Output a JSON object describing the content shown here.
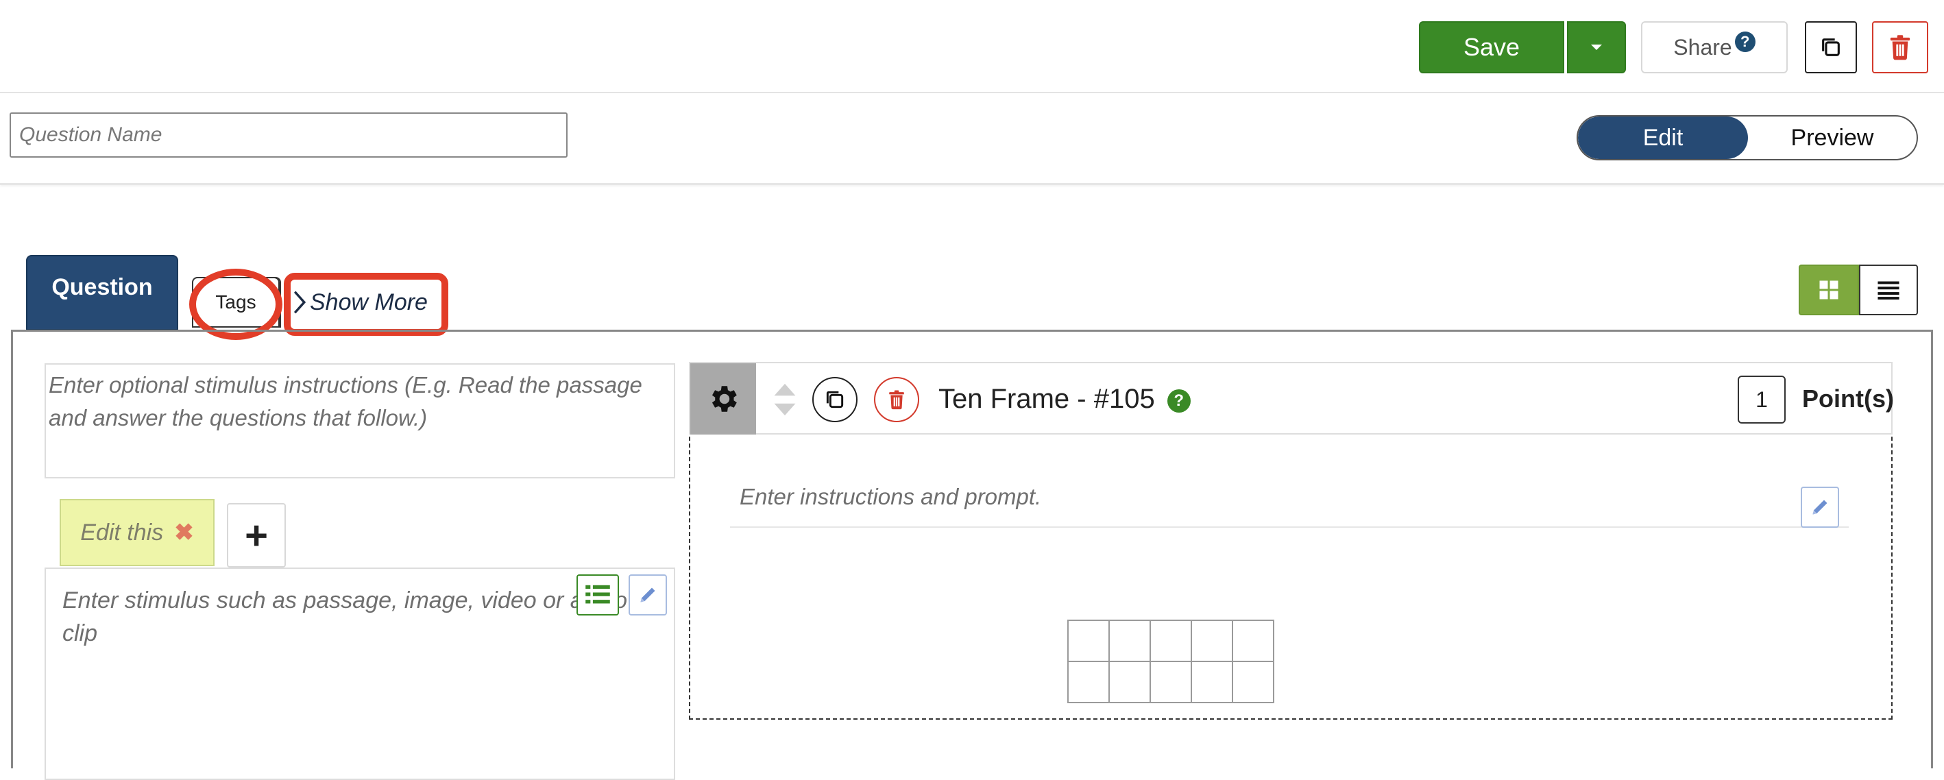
{
  "toolbar": {
    "save_label": "Save",
    "share_label": "Share",
    "share_help": "?",
    "colors": {
      "save_green": "#3a8a26",
      "delete_red": "#d33a2c",
      "help_blue": "#1f4e73"
    }
  },
  "name_row": {
    "question_name_placeholder": "Question Name",
    "question_name_value": "",
    "mode": {
      "edit_label": "Edit",
      "preview_label": "Preview",
      "selected": "Edit",
      "accent": "#264a74"
    }
  },
  "tabs": {
    "question_label": "Question",
    "tags_label": "Tags",
    "show_more_label": "Show More",
    "view_modes": [
      "grid",
      "list"
    ],
    "active_view": "grid"
  },
  "stimulus": {
    "instructions_placeholder": "Enter optional stimulus instructions (E.g. Read the passage and answer the questions that follow.)",
    "tab_label": "Edit this",
    "editor_placeholder": "Enter stimulus such as passage, image, video or audio clip"
  },
  "widget": {
    "title": "Ten Frame - #105",
    "help": "?",
    "points_value": "1",
    "points_label": "Point(s)",
    "prompt_placeholder": "Enter instructions and prompt.",
    "ten_frame": {
      "rows": 2,
      "cols": 5
    }
  },
  "annotations": {
    "highlight_color": "#e23d28",
    "highlighted_items": [
      "Tags",
      "Show More"
    ]
  }
}
